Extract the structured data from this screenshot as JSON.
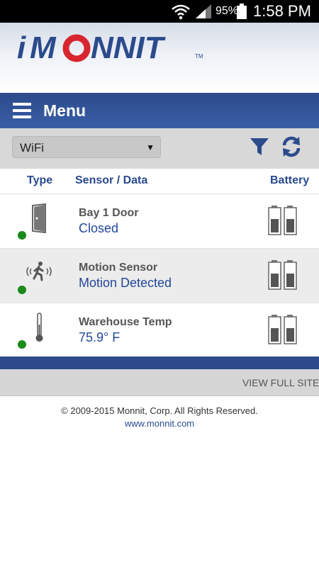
{
  "status_bar": {
    "battery_pct": "95%",
    "time": "1:58 PM"
  },
  "app": {
    "logo_text": "iMONNIT"
  },
  "menu": {
    "label": "Menu"
  },
  "filter": {
    "network_selected": "WiFi"
  },
  "table": {
    "headers": {
      "type": "Type",
      "sensor_data": "Sensor / Data",
      "battery": "Battery"
    },
    "rows": [
      {
        "name": "Bay 1 Door",
        "reading": "Closed",
        "icon": "door-icon",
        "status_color": "#1a8a1a"
      },
      {
        "name": "Motion Sensor",
        "reading": "Motion Detected",
        "icon": "motion-icon",
        "status_color": "#1a8a1a"
      },
      {
        "name": "Warehouse Temp",
        "reading": "75.9° F",
        "icon": "thermometer-icon",
        "status_color": "#1a8a1a"
      }
    ]
  },
  "footer": {
    "view_full_site": "VIEW FULL SITE",
    "copyright": "© 2009-2015 Monnit, Corp. All Rights Reserved.",
    "site_link": "www.monnit.com"
  },
  "colors": {
    "brand_blue": "#2c4a8c",
    "accent_red": "#d7262f",
    "link_blue": "#23489a"
  }
}
